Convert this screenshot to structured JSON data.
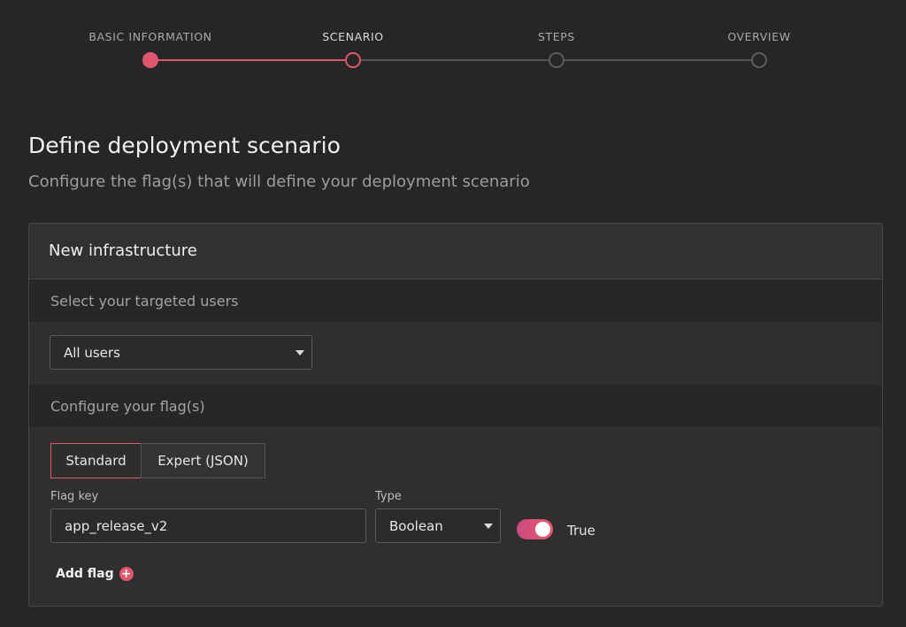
{
  "stepper": {
    "steps": [
      {
        "label": "BASIC INFORMATION",
        "state": "done"
      },
      {
        "label": "SCENARIO",
        "state": "current"
      },
      {
        "label": "STEPS",
        "state": "pending"
      },
      {
        "label": "OVERVIEW",
        "state": "pending"
      }
    ]
  },
  "page": {
    "title": "Define deployment scenario",
    "subtitle": "Configure the flag(s) that will define your deployment scenario"
  },
  "card": {
    "title": "New infrastructure",
    "targeting": {
      "header": "Select your targeted users",
      "selected": "All users"
    },
    "flags": {
      "header": "Configure your flag(s)",
      "tabs": [
        "Standard",
        "Expert (JSON)"
      ],
      "active_tab": "Standard",
      "flag_key_label": "Flag key",
      "flag_key_value": "app_release_v2",
      "type_label": "Type",
      "type_value": "Boolean",
      "toggle_value_label": "True",
      "toggle_on": true,
      "add_flag_label": "Add flag"
    }
  },
  "colors": {
    "accent": "#e0566f",
    "background": "#262626"
  }
}
